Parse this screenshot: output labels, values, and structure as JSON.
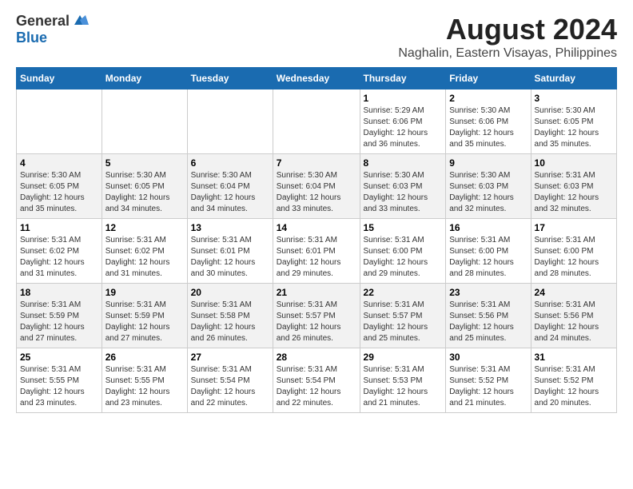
{
  "logo": {
    "general": "General",
    "blue": "Blue"
  },
  "title": "August 2024",
  "subtitle": "Naghalin, Eastern Visayas, Philippines",
  "headers": [
    "Sunday",
    "Monday",
    "Tuesday",
    "Wednesday",
    "Thursday",
    "Friday",
    "Saturday"
  ],
  "weeks": [
    [
      {
        "day": "",
        "info": ""
      },
      {
        "day": "",
        "info": ""
      },
      {
        "day": "",
        "info": ""
      },
      {
        "day": "",
        "info": ""
      },
      {
        "day": "1",
        "info": "Sunrise: 5:29 AM\nSunset: 6:06 PM\nDaylight: 12 hours\nand 36 minutes."
      },
      {
        "day": "2",
        "info": "Sunrise: 5:30 AM\nSunset: 6:06 PM\nDaylight: 12 hours\nand 35 minutes."
      },
      {
        "day": "3",
        "info": "Sunrise: 5:30 AM\nSunset: 6:05 PM\nDaylight: 12 hours\nand 35 minutes."
      }
    ],
    [
      {
        "day": "4",
        "info": "Sunrise: 5:30 AM\nSunset: 6:05 PM\nDaylight: 12 hours\nand 35 minutes."
      },
      {
        "day": "5",
        "info": "Sunrise: 5:30 AM\nSunset: 6:05 PM\nDaylight: 12 hours\nand 34 minutes."
      },
      {
        "day": "6",
        "info": "Sunrise: 5:30 AM\nSunset: 6:04 PM\nDaylight: 12 hours\nand 34 minutes."
      },
      {
        "day": "7",
        "info": "Sunrise: 5:30 AM\nSunset: 6:04 PM\nDaylight: 12 hours\nand 33 minutes."
      },
      {
        "day": "8",
        "info": "Sunrise: 5:30 AM\nSunset: 6:03 PM\nDaylight: 12 hours\nand 33 minutes."
      },
      {
        "day": "9",
        "info": "Sunrise: 5:30 AM\nSunset: 6:03 PM\nDaylight: 12 hours\nand 32 minutes."
      },
      {
        "day": "10",
        "info": "Sunrise: 5:31 AM\nSunset: 6:03 PM\nDaylight: 12 hours\nand 32 minutes."
      }
    ],
    [
      {
        "day": "11",
        "info": "Sunrise: 5:31 AM\nSunset: 6:02 PM\nDaylight: 12 hours\nand 31 minutes."
      },
      {
        "day": "12",
        "info": "Sunrise: 5:31 AM\nSunset: 6:02 PM\nDaylight: 12 hours\nand 31 minutes."
      },
      {
        "day": "13",
        "info": "Sunrise: 5:31 AM\nSunset: 6:01 PM\nDaylight: 12 hours\nand 30 minutes."
      },
      {
        "day": "14",
        "info": "Sunrise: 5:31 AM\nSunset: 6:01 PM\nDaylight: 12 hours\nand 29 minutes."
      },
      {
        "day": "15",
        "info": "Sunrise: 5:31 AM\nSunset: 6:00 PM\nDaylight: 12 hours\nand 29 minutes."
      },
      {
        "day": "16",
        "info": "Sunrise: 5:31 AM\nSunset: 6:00 PM\nDaylight: 12 hours\nand 28 minutes."
      },
      {
        "day": "17",
        "info": "Sunrise: 5:31 AM\nSunset: 6:00 PM\nDaylight: 12 hours\nand 28 minutes."
      }
    ],
    [
      {
        "day": "18",
        "info": "Sunrise: 5:31 AM\nSunset: 5:59 PM\nDaylight: 12 hours\nand 27 minutes."
      },
      {
        "day": "19",
        "info": "Sunrise: 5:31 AM\nSunset: 5:59 PM\nDaylight: 12 hours\nand 27 minutes."
      },
      {
        "day": "20",
        "info": "Sunrise: 5:31 AM\nSunset: 5:58 PM\nDaylight: 12 hours\nand 26 minutes."
      },
      {
        "day": "21",
        "info": "Sunrise: 5:31 AM\nSunset: 5:57 PM\nDaylight: 12 hours\nand 26 minutes."
      },
      {
        "day": "22",
        "info": "Sunrise: 5:31 AM\nSunset: 5:57 PM\nDaylight: 12 hours\nand 25 minutes."
      },
      {
        "day": "23",
        "info": "Sunrise: 5:31 AM\nSunset: 5:56 PM\nDaylight: 12 hours\nand 25 minutes."
      },
      {
        "day": "24",
        "info": "Sunrise: 5:31 AM\nSunset: 5:56 PM\nDaylight: 12 hours\nand 24 minutes."
      }
    ],
    [
      {
        "day": "25",
        "info": "Sunrise: 5:31 AM\nSunset: 5:55 PM\nDaylight: 12 hours\nand 23 minutes."
      },
      {
        "day": "26",
        "info": "Sunrise: 5:31 AM\nSunset: 5:55 PM\nDaylight: 12 hours\nand 23 minutes."
      },
      {
        "day": "27",
        "info": "Sunrise: 5:31 AM\nSunset: 5:54 PM\nDaylight: 12 hours\nand 22 minutes."
      },
      {
        "day": "28",
        "info": "Sunrise: 5:31 AM\nSunset: 5:54 PM\nDaylight: 12 hours\nand 22 minutes."
      },
      {
        "day": "29",
        "info": "Sunrise: 5:31 AM\nSunset: 5:53 PM\nDaylight: 12 hours\nand 21 minutes."
      },
      {
        "day": "30",
        "info": "Sunrise: 5:31 AM\nSunset: 5:52 PM\nDaylight: 12 hours\nand 21 minutes."
      },
      {
        "day": "31",
        "info": "Sunrise: 5:31 AM\nSunset: 5:52 PM\nDaylight: 12 hours\nand 20 minutes."
      }
    ]
  ]
}
